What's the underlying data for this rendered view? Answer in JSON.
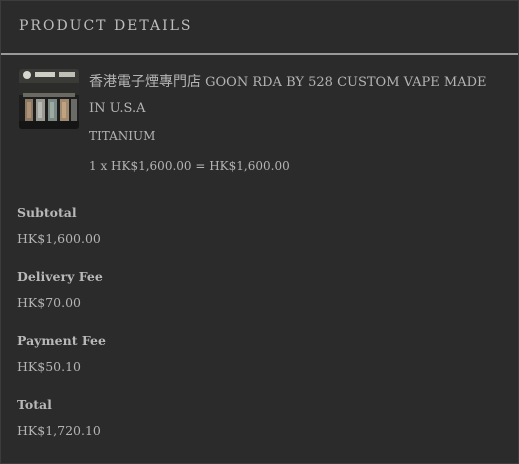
{
  "header": {
    "title": "PRODUCT DETAILS"
  },
  "product": {
    "image_icon": "product-thumbnail",
    "name_cn": "香港電子煙專門店",
    "name_en": "GOON RDA BY 528 CUSTOM VAPE MADE IN U.S.A",
    "variant": "TITANIUM",
    "line_calculation": "1 x HK$1,600.00 = HK$1,600.00"
  },
  "summary": {
    "subtotal_label": "Subtotal",
    "subtotal_value": "HK$1,600.00",
    "delivery_label": "Delivery Fee",
    "delivery_value": "HK$70.00",
    "payment_label": "Payment Fee",
    "payment_value": "HK$50.10",
    "total_label": "Total",
    "total_value": "HK$1,720.10"
  },
  "colors": {
    "background": "#2b2b2b",
    "text": "#b8b8b8",
    "divider": "#9a9a9a"
  }
}
